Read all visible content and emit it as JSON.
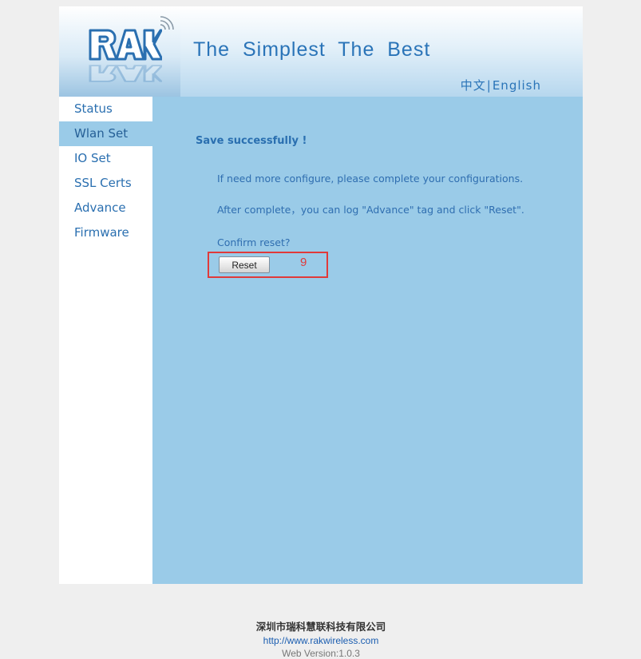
{
  "header": {
    "logo_text": "RAK",
    "slogan": "The  Simplest  The  Best",
    "lang_zh": "中文",
    "lang_sep": "|",
    "lang_en": "English"
  },
  "sidebar": {
    "items": [
      {
        "label": "Status",
        "active": false
      },
      {
        "label": "Wlan Set",
        "active": true
      },
      {
        "label": "IO Set",
        "active": false
      },
      {
        "label": "SSL Certs",
        "active": false
      },
      {
        "label": "Advance",
        "active": false
      },
      {
        "label": "Firmware",
        "active": false
      }
    ]
  },
  "main": {
    "title": "Save successfully !",
    "line1": "If need more configure, please complete your configurations.",
    "line2": "After complete，you can log \"Advance\" tag and click \"Reset\".",
    "confirm": "Confirm reset?",
    "reset_label": "Reset",
    "annotation": "9"
  },
  "footer": {
    "company": "深圳市瑞科慧联科技有限公司",
    "url": "http://www.rakwireless.com",
    "version": "Web Version:1.0.3"
  },
  "colors": {
    "accent": "#2a74b8",
    "content_bg": "#9acbe8",
    "annotation": "#e03a3a"
  }
}
